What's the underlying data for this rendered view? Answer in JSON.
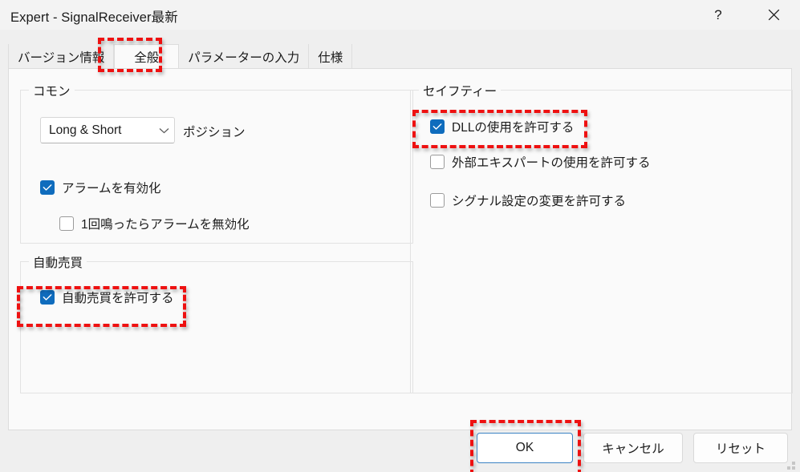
{
  "window": {
    "title": "Expert - SignalReceiver最新",
    "help_icon": "?",
    "close_icon": "close-icon"
  },
  "tabs": [
    {
      "label": "バージョン情報",
      "selected": false
    },
    {
      "label": "全般",
      "selected": true
    },
    {
      "label": "パラメーターの入力",
      "selected": false
    },
    {
      "label": "仕様",
      "selected": false
    }
  ],
  "groups": {
    "common": {
      "legend": "コモン",
      "position_combo": {
        "value": "Long & Short",
        "arrow_icon": "chevron-down-icon",
        "label": "ポジション"
      },
      "checkboxes": [
        {
          "label": "アラームを有効化",
          "checked": true
        },
        {
          "label": "1回鳴ったらアラームを無効化",
          "checked": false
        }
      ]
    },
    "autotrade": {
      "legend": "自動売買",
      "checkboxes": [
        {
          "label": "自動売買を許可する",
          "checked": true
        }
      ]
    },
    "safety": {
      "legend": "セイフティー",
      "checkboxes": [
        {
          "label": "DLLの使用を許可する",
          "checked": true
        },
        {
          "label": "外部エキスパートの使用を許可する",
          "checked": false
        },
        {
          "label": "シグナル設定の変更を許可する",
          "checked": false
        }
      ]
    }
  },
  "buttons": {
    "ok": "OK",
    "cancel": "キャンセル",
    "reset": "リセット"
  },
  "annotations": {
    "color": "#ee1111",
    "targets": [
      "tab-general",
      "allow-dll-checkbox",
      "allow-autotrade-checkbox",
      "ok-button"
    ]
  },
  "colors": {
    "accent": "#0f6cbd",
    "titlebar_bg": "#f3f3f3",
    "tabband_bg": "#efefef",
    "content_bg": "#fafafa",
    "default_button_border": "#3b82c4"
  }
}
